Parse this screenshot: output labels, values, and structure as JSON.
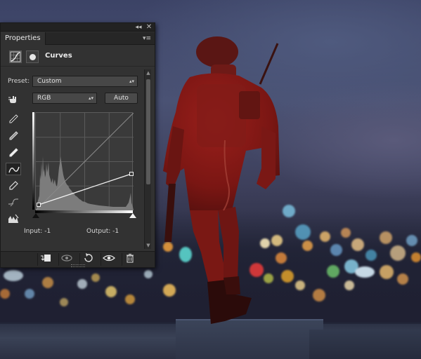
{
  "panel": {
    "tab_label": "Properties",
    "collapse_glyph": "◂◂",
    "close_glyph": "✕",
    "menu_glyph": "▾≡",
    "adjustment_title": "Curves",
    "preset_label": "Preset:",
    "preset_value": "Custom",
    "channel_value": "RGB",
    "auto_label": "Auto",
    "input_text": "Input: -1",
    "output_text": "Output: -1"
  },
  "icons": {
    "curves_adjustment": "curves-icon",
    "layer_mask": "mask-icon",
    "on_image_tool": "hand-target-icon",
    "black_point": "eyedropper-black-icon",
    "gray_point": "eyedropper-gray-icon",
    "white_point": "eyedropper-white-icon",
    "edit_points": "curve-points-icon",
    "draw_curve": "pencil-icon",
    "smooth": "smooth-curve-icon",
    "clipping": "clipping-warning-icon",
    "clip_to_layer": "clip-layer-icon",
    "view_previous": "view-previous-icon",
    "reset": "reset-icon",
    "visibility": "eye-icon",
    "delete": "trash-icon"
  },
  "colors": {
    "panel_bg": "#323232",
    "soldier_tint": "#8e1b18"
  }
}
